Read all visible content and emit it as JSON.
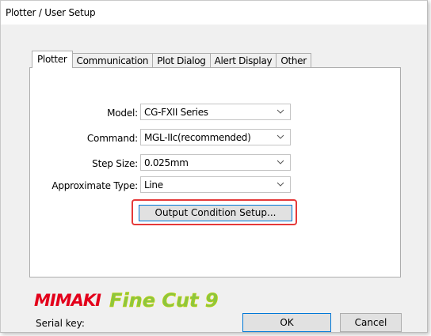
{
  "window": {
    "title": "Plotter / User Setup"
  },
  "tabs": [
    {
      "label": "Plotter",
      "active": true
    },
    {
      "label": "Communication",
      "active": false
    },
    {
      "label": "Plot Dialog",
      "active": false
    },
    {
      "label": "Alert Display",
      "active": false
    },
    {
      "label": "Other",
      "active": false
    }
  ],
  "form": {
    "model": {
      "label": "Model:",
      "value": "CG-FXII Series"
    },
    "command": {
      "label": "Command:",
      "value": "MGL-IIc(recommended)"
    },
    "step_size": {
      "label": "Step Size:",
      "value": "0.025mm"
    },
    "approximate_type": {
      "label": "Approximate Type:",
      "value": "Line"
    }
  },
  "buttons": {
    "output_condition": "Output Condition Setup...",
    "ok": "OK",
    "cancel": "Cancel"
  },
  "footer": {
    "serial_label": "Serial key:",
    "logo_brand": "MIMAKI",
    "logo_product": "Fine Cut 9"
  },
  "colors": {
    "highlight": "#e53a3a",
    "accent": "#0078d7",
    "mimaki_red": "#e3001b",
    "finecut_green": "#8cc63f",
    "finecut_yellow": "#c8d400"
  }
}
